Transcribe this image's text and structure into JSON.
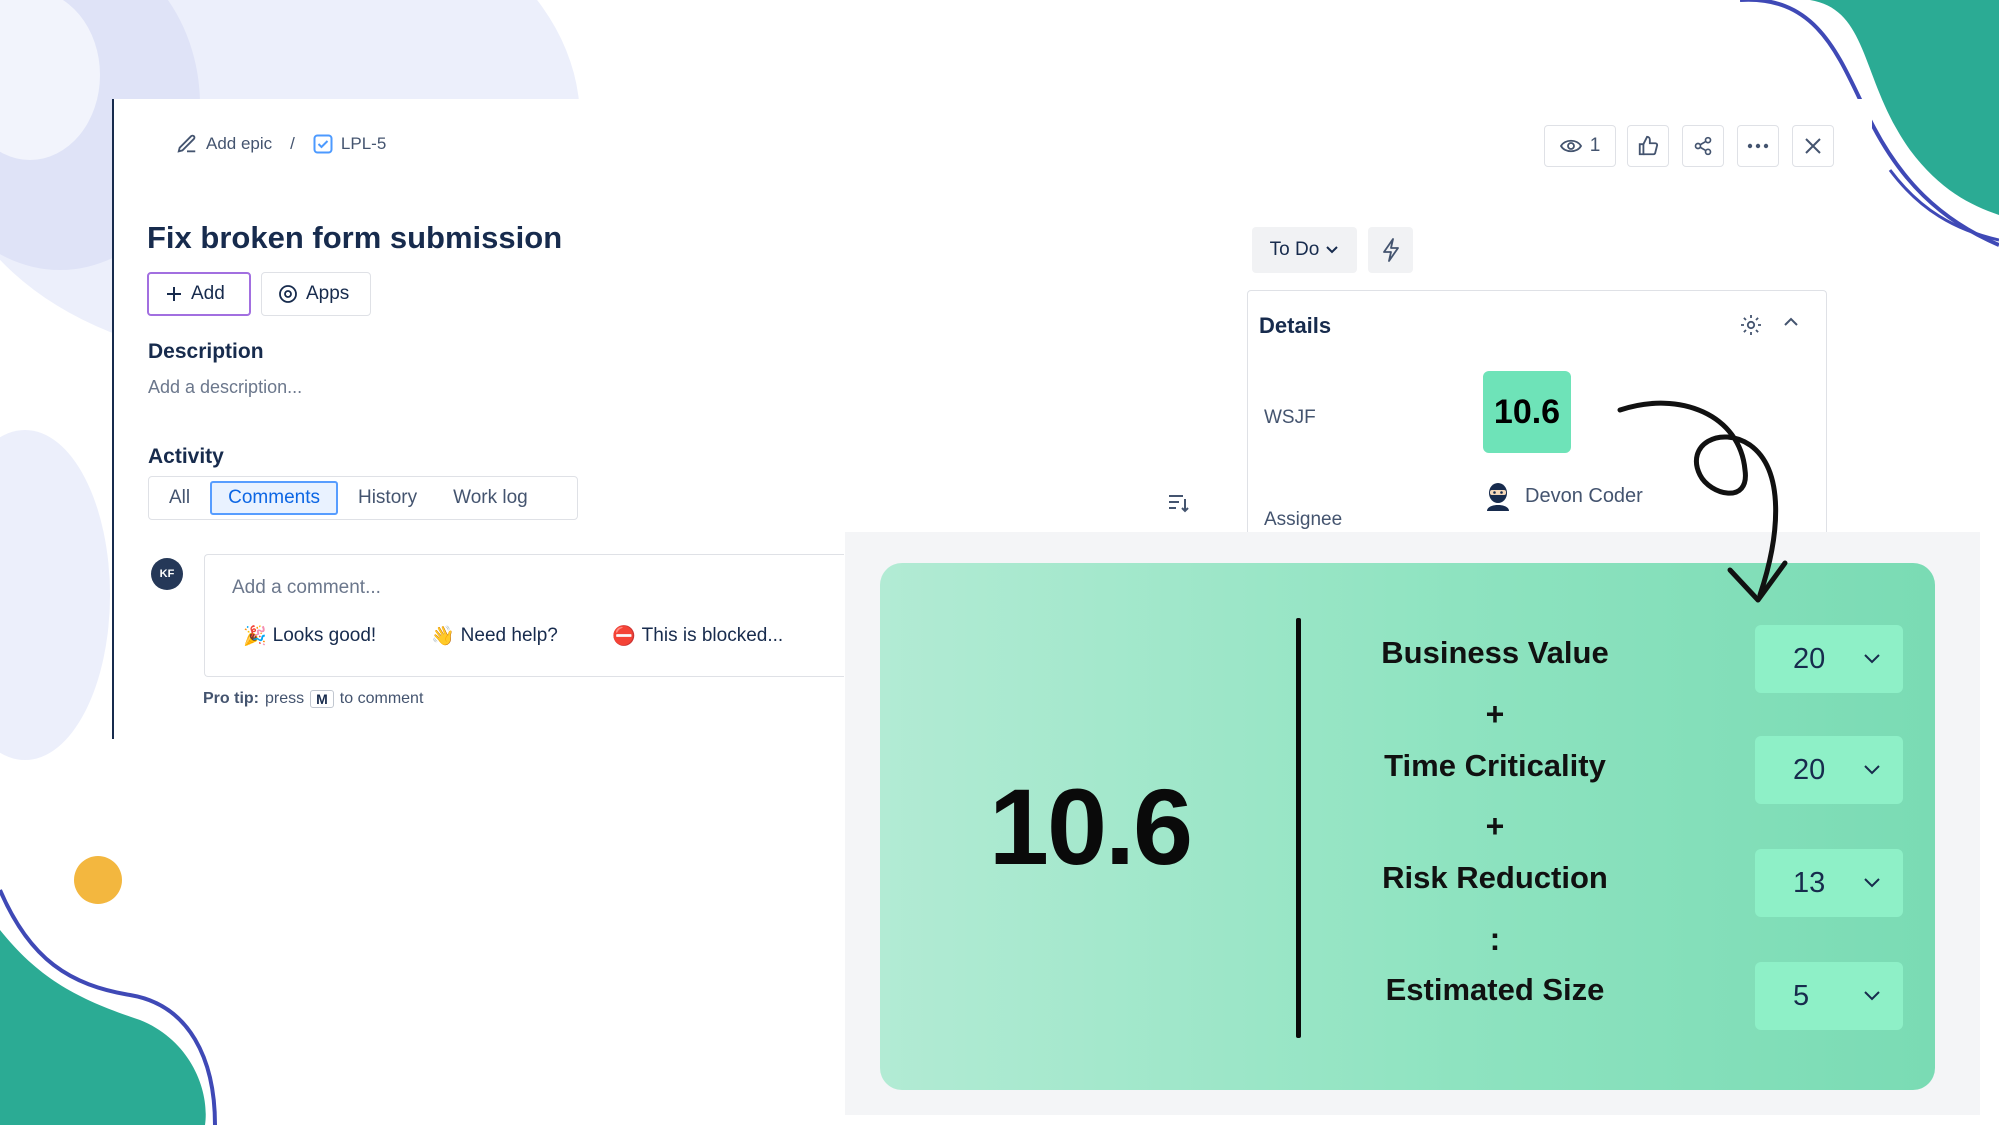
{
  "breadcrumb": {
    "epic_label": "Add epic",
    "separator": "/",
    "issue_key": "LPL-5"
  },
  "issue": {
    "title": "Fix broken form submission",
    "add_label": "Add",
    "apps_label": "Apps"
  },
  "description": {
    "heading": "Description",
    "placeholder": "Add a description..."
  },
  "activity": {
    "heading": "Activity",
    "tabs": [
      {
        "label": "All",
        "active": false
      },
      {
        "label": "Comments",
        "active": true
      },
      {
        "label": "History",
        "active": false
      },
      {
        "label": "Work log",
        "active": false
      }
    ]
  },
  "comment": {
    "avatar_initials": "KF",
    "placeholder": "Add a comment...",
    "quick_replies": [
      {
        "emoji": "🎉",
        "label": "Looks good!"
      },
      {
        "emoji": "👋",
        "label": "Need help?"
      },
      {
        "emoji": "⛔",
        "label": "This is blocked..."
      }
    ],
    "pro_tip_prefix": "Pro tip:",
    "pro_tip_press": "press",
    "pro_tip_key": "M",
    "pro_tip_suffix": "to comment"
  },
  "toolbar": {
    "watch_count": "1",
    "icons": [
      "eye-icon",
      "thumbs-up-icon",
      "share-icon",
      "more-icon",
      "close-icon"
    ]
  },
  "status": {
    "value": "To Do"
  },
  "details": {
    "heading": "Details",
    "wsjf_label": "WSJF",
    "wsjf_value": "10.6",
    "assignee_label": "Assignee",
    "assignee_name": "Devon Coder"
  },
  "wsjf_panel": {
    "score": "10.6",
    "factors": [
      {
        "label": "Business Value",
        "value": "20"
      },
      {
        "label": "Time Criticality",
        "value": "20"
      },
      {
        "label": "Risk Reduction",
        "value": "13"
      },
      {
        "label": "Estimated Size",
        "value": "5"
      }
    ],
    "operators": [
      "+",
      "+",
      ":"
    ]
  },
  "colors": {
    "accent_purple": "#a26fe0",
    "tab_active": "#0c66e4",
    "wsjf_badge": "#6ee3b8",
    "teal_decoration": "#2bab94",
    "yellow_dot": "#f3b73f"
  }
}
